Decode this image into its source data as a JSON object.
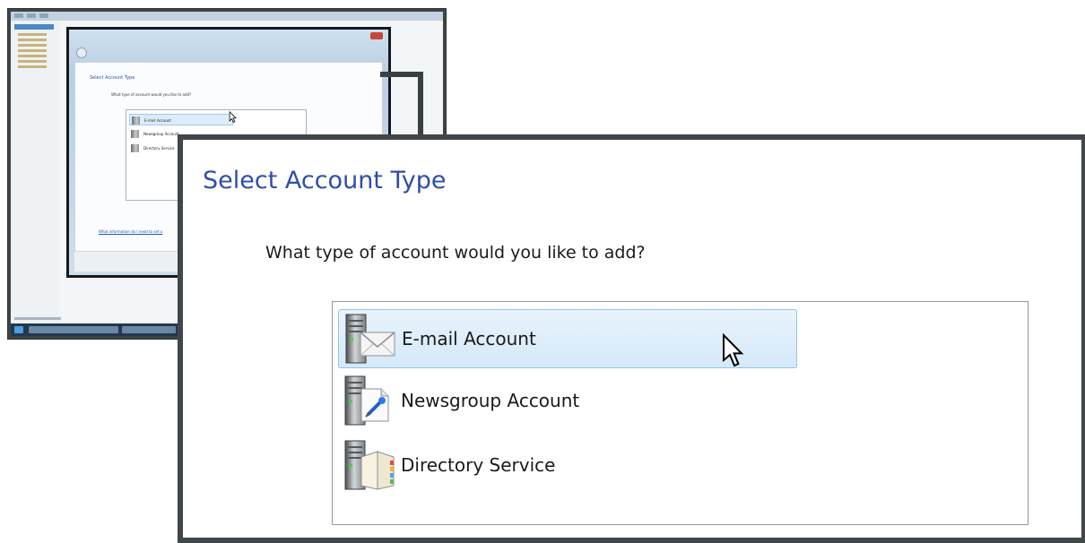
{
  "dialog": {
    "title": "Select Account Type",
    "question": "What type of account would you like to add?",
    "help_link": "What information do I need to set u"
  },
  "account_types": [
    {
      "label": "E-mail Account",
      "icon": "email-server-icon",
      "selected": true
    },
    {
      "label": "Newsgroup Account",
      "icon": "newsgroup-server-icon",
      "selected": false
    },
    {
      "label": "Directory Service",
      "icon": "directory-server-icon",
      "selected": false
    }
  ],
  "colors": {
    "title_blue": "#2f4ea8",
    "selection_fill": "#d5e9f9",
    "selection_border": "#8fc4ec",
    "frame_dark": "#40464a"
  }
}
